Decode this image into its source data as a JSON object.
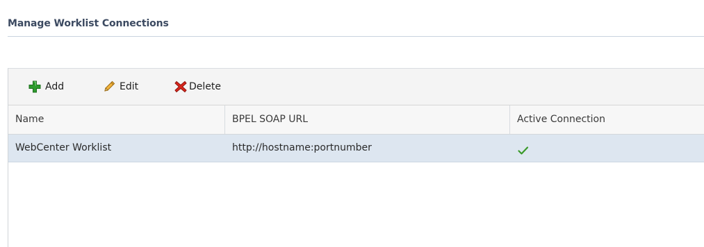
{
  "section": {
    "title": "Manage Worklist Connections"
  },
  "toolbar": {
    "add_label": "Add",
    "edit_label": "Edit",
    "delete_label": "Delete"
  },
  "table": {
    "columns": [
      "Name",
      "BPEL SOAP URL",
      "Active Connection"
    ],
    "rows": [
      {
        "name": "WebCenter Worklist",
        "url": "http://hostname:portnumber",
        "active": true,
        "active_icon": "checkmark-icon"
      }
    ],
    "selected_row_color": "#dde6f0"
  },
  "colors": {
    "title": "#3c4a61",
    "add_icon": "#2e9b2e",
    "delete_icon": "#d9261c",
    "check_icon": "#3a9a2a"
  }
}
